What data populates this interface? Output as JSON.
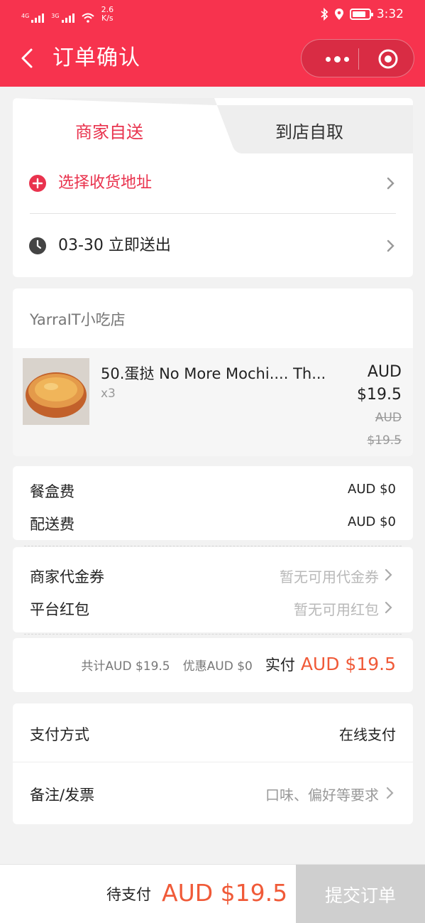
{
  "status_bar": {
    "sim1_label": "4G",
    "sim2_label": "3G",
    "net_speed": "2.6",
    "net_speed_unit": "K/s",
    "time": "3:32",
    "icons": [
      "bluetooth-icon",
      "location-icon",
      "battery-icon"
    ]
  },
  "nav": {
    "title": "订单确认",
    "back_icon": "chevron-left-icon",
    "menu_icon": "more-dots-icon",
    "close_icon": "target-circle-icon"
  },
  "delivery": {
    "tab_delivery": "商家自送",
    "tab_pickup": "到店自取",
    "address_label": "选择收货地址",
    "time_label": "03-30 立即送出"
  },
  "shop": {
    "name": "YarraIT小吃店"
  },
  "item": {
    "name": "50.蛋挞 No More Mochi.... Th...",
    "qty": "x3",
    "price_currency": "AUD",
    "price_value": "$19.5",
    "old_currency": "AUD",
    "old_value": "$19.5"
  },
  "fees": {
    "box_fee_label": "餐盒费",
    "box_fee_value": "AUD $0",
    "delivery_fee_label": "配送费",
    "delivery_fee_value": "AUD $0"
  },
  "coupons": {
    "merchant_label": "商家代金券",
    "merchant_value": "暂无可用代金券",
    "platform_label": "平台红包",
    "platform_value": "暂无可用红包"
  },
  "totals": {
    "subtotal": "共计AUD $19.5",
    "discount": "优惠AUD $0",
    "paid_label": "实付",
    "paid_value": "AUD $19.5"
  },
  "payment": {
    "label": "支付方式",
    "value": "在线支付"
  },
  "remark": {
    "label": "备注/发票",
    "placeholder": "口味、偏好等要求"
  },
  "bottom": {
    "pending_label": "待支付",
    "pending_value": "AUD $19.5",
    "submit_label": "提交订单"
  },
  "colors": {
    "brand": "#f7334e",
    "accent_price": "#f05a38",
    "tab_active_text": "#e9334e",
    "submit_disabled": "#cfcfcf"
  }
}
